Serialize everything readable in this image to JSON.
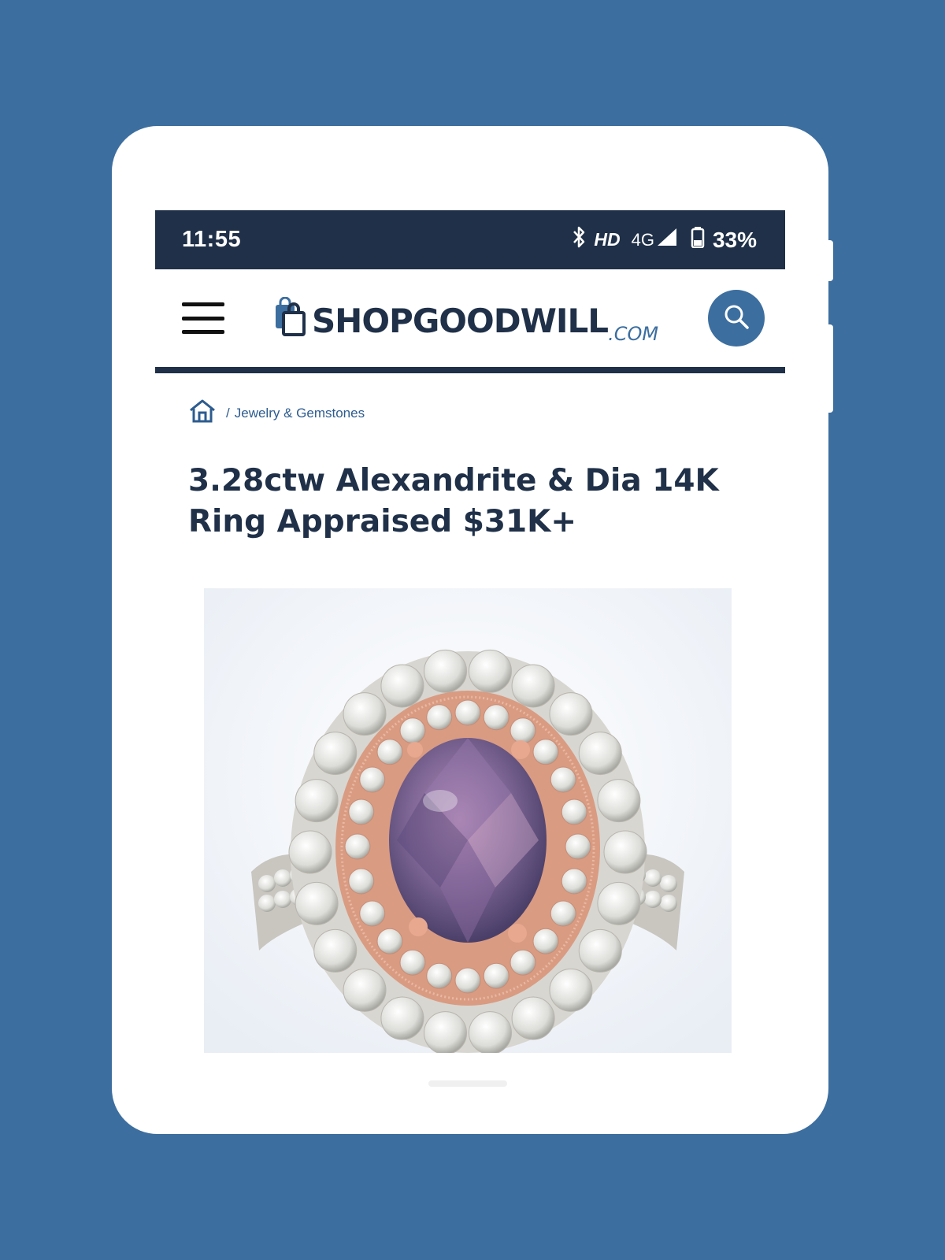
{
  "status_bar": {
    "time": "11:55",
    "hd": "HD",
    "network": "4G",
    "battery": "33%"
  },
  "header": {
    "logo_main": "SHOPGOODWILL",
    "logo_suffix": ".COM"
  },
  "breadcrumb": {
    "separator": "/",
    "category": "Jewelry & Gemstones"
  },
  "product": {
    "title": "3.28ctw Alexandrite & Dia 14K Ring Appraised $31K+"
  },
  "icons": {
    "bluetooth": "bluetooth-icon",
    "signal": "signal-icon",
    "battery": "battery-icon",
    "menu": "hamburger-menu-icon",
    "bag": "shopping-bag-icon",
    "search": "search-icon",
    "home": "home-icon"
  },
  "colors": {
    "background": "#3c6e9f",
    "navy": "#1f3048",
    "accent": "#3c6e9f"
  }
}
